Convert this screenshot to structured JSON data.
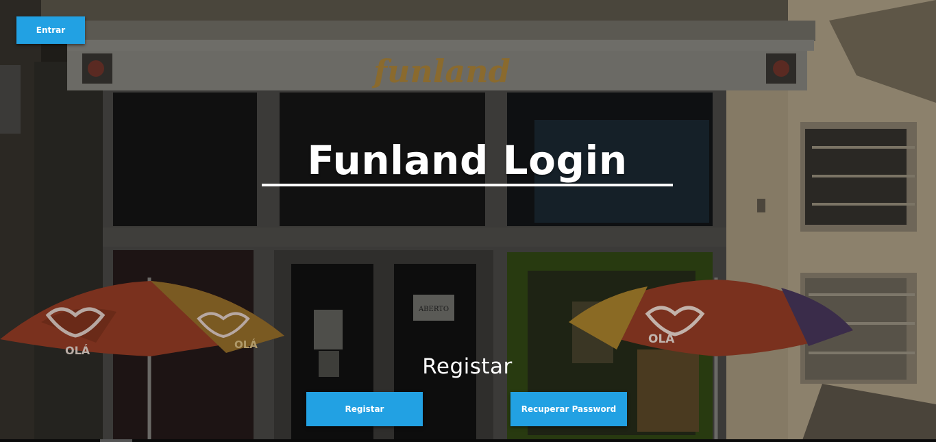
{
  "header": {
    "enter_label": "Entrar"
  },
  "hero": {
    "title": "Funland Login",
    "sign_text": "funland",
    "umbrella_brand": "OLÁ",
    "door_sign": "ABERTO"
  },
  "actions": {
    "section_label": "Registar",
    "register_label": "Registar",
    "recover_label": "Recuperar Password"
  },
  "colors": {
    "accent": "#22a1e3",
    "text": "#ffffff"
  }
}
